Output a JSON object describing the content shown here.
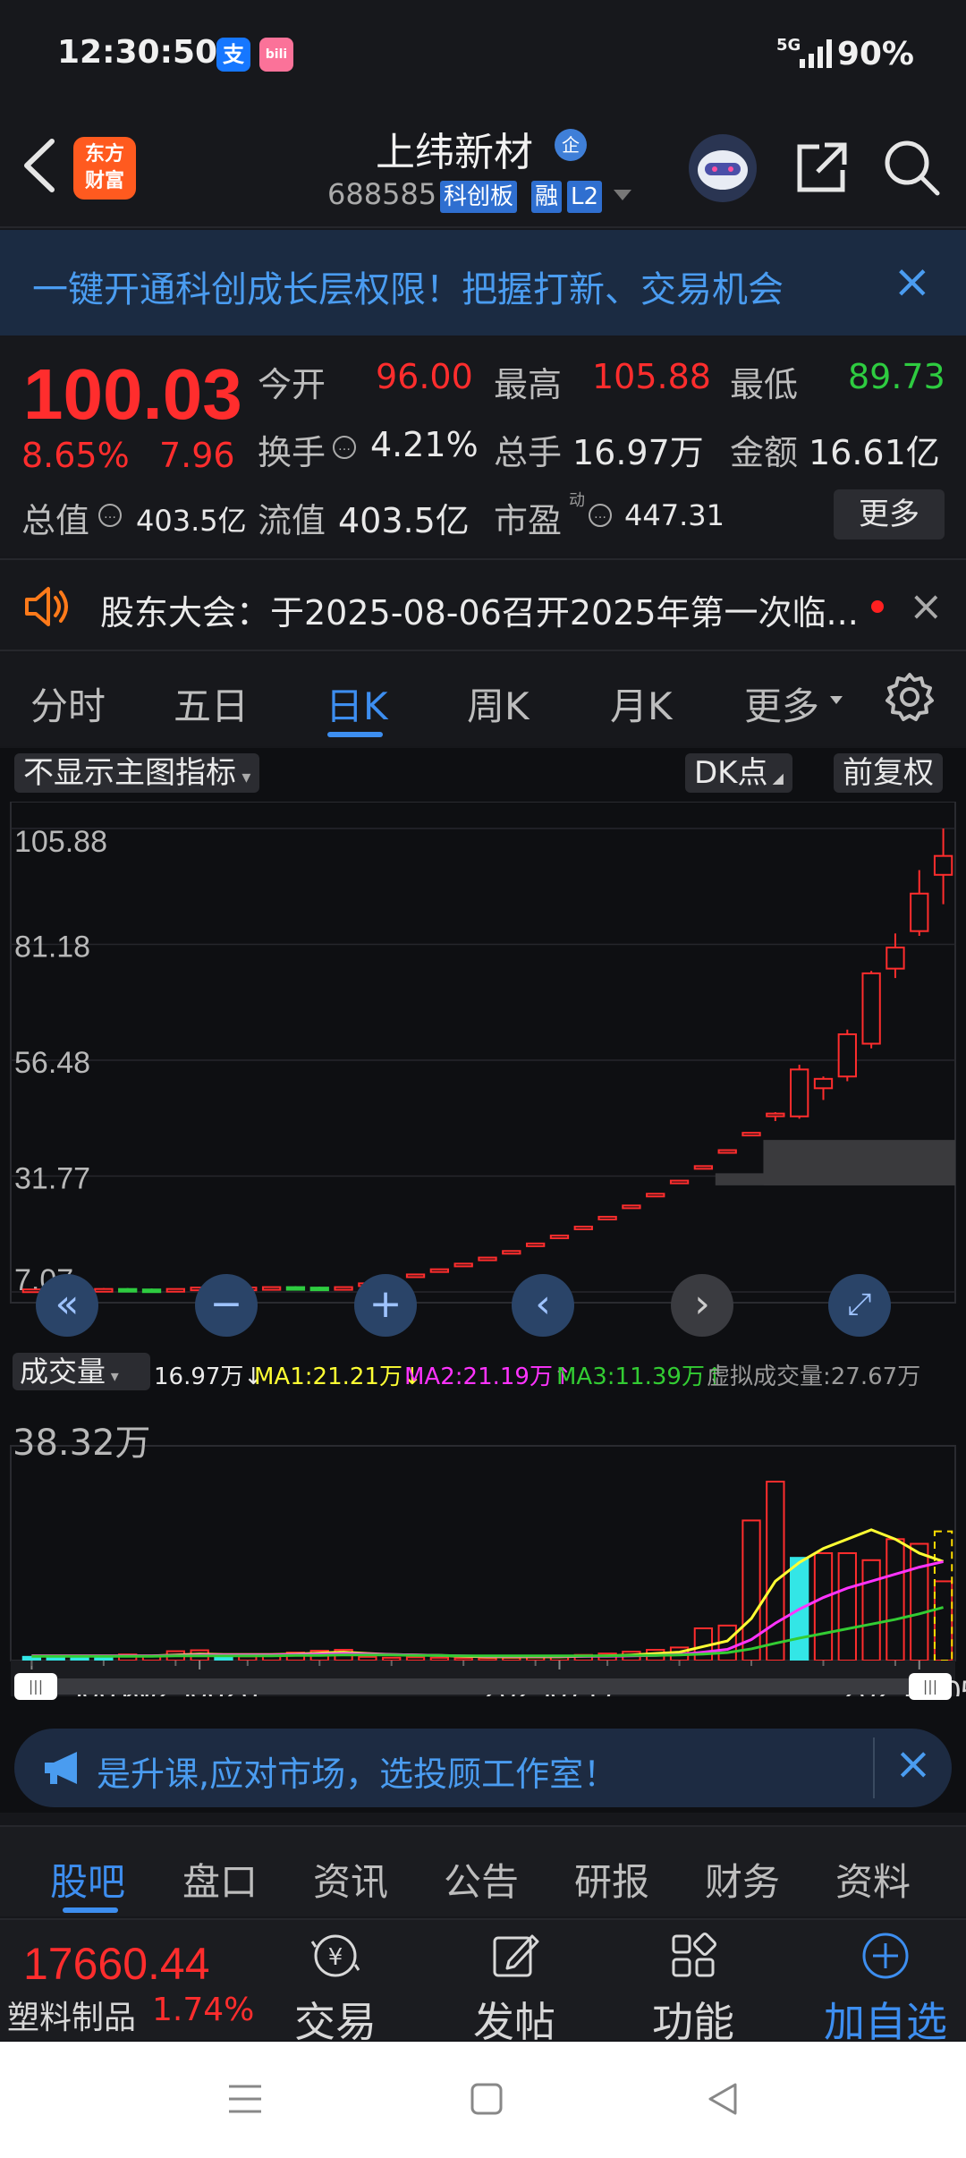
{
  "status_bar": {
    "time": "12:30:50",
    "apps": [
      "支",
      "bili"
    ],
    "network": "5G",
    "battery": "90%"
  },
  "header": {
    "logo_line1": "东方",
    "logo_line2": "财富",
    "stock_name": "上纬新材",
    "qi_badge": "企",
    "stock_code": "688585",
    "tags": [
      "科创板",
      "融",
      "L2"
    ]
  },
  "banner": {
    "text": "一键开通科创成长层权限！把握打新、交易机会"
  },
  "quote": {
    "price": "100.03",
    "change_pct": "8.65%",
    "change_amt": "7.96",
    "open_label": "今开",
    "open": "96.00",
    "high_label": "最高",
    "high": "105.88",
    "low_label": "最低",
    "low": "89.73",
    "turnover_label": "换手",
    "turnover": "4.21%",
    "volume_label": "总手",
    "volume": "16.97万",
    "amount_label": "金额",
    "amount": "16.61亿",
    "mktcap_label": "总值",
    "mktcap": "403.5亿",
    "float_label": "流值",
    "float": "403.5亿",
    "pe_label": "市盈",
    "pe_sup": "动",
    "pe": "447.31",
    "more": "更多"
  },
  "notice": {
    "text": "股东大会：于2025-08-06召开2025年第一次临..."
  },
  "period_tabs": [
    "分时",
    "五日",
    "日K",
    "周K",
    "月K",
    "更多"
  ],
  "chart_controls": {
    "indicator": "不显示主图指标",
    "dk": "DK点",
    "adjust": "前复权",
    "volume_label": "成交量",
    "vol_value": "16.97万↓",
    "ma1": "MA1:21.21万↓",
    "ma2": "MA2:21.19万↑",
    "ma3": "MA3:11.39万↑",
    "virtual": "虚拟成交量:27.67万",
    "vol_max": "38.32万"
  },
  "colors": {
    "up": "#ff2d2d",
    "down": "#2ecc40",
    "accent": "#3d8ef0",
    "ma1": "#ffff33",
    "ma2": "#ff33ff",
    "ma3": "#33cc33"
  },
  "chart_data": {
    "type": "candlestick",
    "y_ticks": [
      "105.88",
      "81.18",
      "56.48",
      "31.77",
      "7.07"
    ],
    "ylim": [
      7.07,
      105.88
    ],
    "x_ticks": [
      "20250616",
      "20250626",
      "20250717",
      "20250805"
    ],
    "series": [
      {
        "o": 7.5,
        "h": 7.7,
        "l": 7.3,
        "c": 7.6
      },
      {
        "o": 7.6,
        "h": 7.8,
        "l": 7.4,
        "c": 7.5
      },
      {
        "o": 7.5,
        "h": 7.7,
        "l": 7.3,
        "c": 7.6
      },
      {
        "o": 7.6,
        "h": 7.9,
        "l": 7.5,
        "c": 7.7
      },
      {
        "o": 7.7,
        "h": 7.9,
        "l": 7.5,
        "c": 7.6
      },
      {
        "o": 7.6,
        "h": 7.8,
        "l": 7.4,
        "c": 7.5
      },
      {
        "o": 7.5,
        "h": 7.8,
        "l": 7.4,
        "c": 7.7
      },
      {
        "o": 7.7,
        "h": 8.1,
        "l": 7.6,
        "c": 8.0
      },
      {
        "o": 8.0,
        "h": 8.2,
        "l": 7.8,
        "c": 7.9
      },
      {
        "o": 7.9,
        "h": 8.1,
        "l": 7.7,
        "c": 8.0
      },
      {
        "o": 8.0,
        "h": 8.2,
        "l": 7.8,
        "c": 8.1
      },
      {
        "o": 8.1,
        "h": 8.3,
        "l": 7.9,
        "c": 8.0
      },
      {
        "o": 8.0,
        "h": 8.2,
        "l": 7.8,
        "c": 7.9
      },
      {
        "o": 7.9,
        "h": 8.2,
        "l": 7.8,
        "c": 8.1
      },
      {
        "o": 8.9,
        "h": 8.9,
        "l": 8.9,
        "c": 8.9
      },
      {
        "o": 9.8,
        "h": 9.8,
        "l": 9.8,
        "c": 9.8
      },
      {
        "o": 10.8,
        "h": 10.8,
        "l": 10.8,
        "c": 10.8
      },
      {
        "o": 11.9,
        "h": 11.9,
        "l": 11.9,
        "c": 11.9
      },
      {
        "o": 13.1,
        "h": 13.1,
        "l": 13.1,
        "c": 13.1
      },
      {
        "o": 14.4,
        "h": 14.4,
        "l": 14.4,
        "c": 14.4
      },
      {
        "o": 15.8,
        "h": 15.8,
        "l": 15.8,
        "c": 15.8
      },
      {
        "o": 17.4,
        "h": 17.4,
        "l": 17.4,
        "c": 17.4
      },
      {
        "o": 19.1,
        "h": 19.1,
        "l": 19.1,
        "c": 19.1
      },
      {
        "o": 21.0,
        "h": 21.0,
        "l": 21.0,
        "c": 21.0
      },
      {
        "o": 23.1,
        "h": 23.1,
        "l": 23.1,
        "c": 23.1
      },
      {
        "o": 25.5,
        "h": 25.5,
        "l": 25.5,
        "c": 25.5
      },
      {
        "o": 28.0,
        "h": 28.0,
        "l": 28.0,
        "c": 28.0
      },
      {
        "o": 30.8,
        "h": 30.8,
        "l": 30.8,
        "c": 30.8
      },
      {
        "o": 33.9,
        "h": 33.9,
        "l": 33.9,
        "c": 33.9
      },
      {
        "o": 37.3,
        "h": 37.3,
        "l": 37.3,
        "c": 37.3
      },
      {
        "o": 41.0,
        "h": 41.0,
        "l": 41.0,
        "c": 41.0
      },
      {
        "o": 45.1,
        "h": 45.4,
        "l": 43.5,
        "c": 45.1
      },
      {
        "o": 44.5,
        "h": 55.5,
        "l": 44.0,
        "c": 54.5
      },
      {
        "o": 50.5,
        "h": 53.0,
        "l": 48.0,
        "c": 52.5
      },
      {
        "o": 53.0,
        "h": 63.0,
        "l": 52.0,
        "c": 62.0
      },
      {
        "o": 60.0,
        "h": 75.5,
        "l": 59.0,
        "c": 75.0
      },
      {
        "o": 76.0,
        "h": 83.5,
        "l": 74.0,
        "c": 80.5
      },
      {
        "o": 84.0,
        "h": 97.0,
        "l": 83.0,
        "c": 92.0
      },
      {
        "o": 96.0,
        "h": 105.88,
        "l": 89.73,
        "c": 100.03
      }
    ],
    "volume": {
      "max_label": "38.32万",
      "bars": [
        {
          "v": 0.8,
          "up": false
        },
        {
          "v": 0.9,
          "up": false
        },
        {
          "v": 0.7,
          "up": false
        },
        {
          "v": 0.8,
          "up": false
        },
        {
          "v": 1.3,
          "up": true
        },
        {
          "v": 0.9,
          "up": true
        },
        {
          "v": 2.0,
          "up": true
        },
        {
          "v": 2.2,
          "up": true
        },
        {
          "v": 1.0,
          "up": false
        },
        {
          "v": 0.9,
          "up": true
        },
        {
          "v": 1.1,
          "up": true
        },
        {
          "v": 1.7,
          "up": true
        },
        {
          "v": 2.1,
          "up": true
        },
        {
          "v": 2.3,
          "up": true
        },
        {
          "v": 0.8,
          "up": true
        },
        {
          "v": 0.6,
          "up": true
        },
        {
          "v": 0.7,
          "up": true
        },
        {
          "v": 0.6,
          "up": true
        },
        {
          "v": 0.5,
          "up": true
        },
        {
          "v": 0.5,
          "up": true
        },
        {
          "v": 0.6,
          "up": true
        },
        {
          "v": 0.7,
          "up": true
        },
        {
          "v": 0.9,
          "up": true
        },
        {
          "v": 1.2,
          "up": true
        },
        {
          "v": 1.5,
          "up": true
        },
        {
          "v": 1.9,
          "up": true
        },
        {
          "v": 2.3,
          "up": true
        },
        {
          "v": 2.8,
          "up": true
        },
        {
          "v": 6.9,
          "up": true
        },
        {
          "v": 7.5,
          "up": true
        },
        {
          "v": 30.0,
          "up": true
        },
        {
          "v": 38.32,
          "up": true
        },
        {
          "v": 22.0,
          "up": false
        },
        {
          "v": 23.0,
          "up": true
        },
        {
          "v": 23.0,
          "up": true
        },
        {
          "v": 21.5,
          "up": true
        },
        {
          "v": 26.0,
          "up": true
        },
        {
          "v": 25.0,
          "up": true
        },
        {
          "v": 16.97,
          "up": true
        }
      ],
      "ma1": [
        1,
        1,
        1,
        1,
        1,
        1,
        1.2,
        1.4,
        1.3,
        1.3,
        1.3,
        1.4,
        1.6,
        1.8,
        1.5,
        1.3,
        1.2,
        1.1,
        0.9,
        0.8,
        0.8,
        0.8,
        0.8,
        0.9,
        1.0,
        1.2,
        1.5,
        1.8,
        3.0,
        4.2,
        9.0,
        17.0,
        21.0,
        24.0,
        26.0,
        28.0,
        26.0,
        23.0,
        21.21
      ],
      "ma2": [
        1,
        1,
        1,
        1,
        1,
        1,
        1.1,
        1.2,
        1.2,
        1.2,
        1.2,
        1.3,
        1.4,
        1.5,
        1.4,
        1.3,
        1.2,
        1.1,
        1.0,
        0.9,
        0.9,
        0.9,
        0.9,
        0.9,
        0.9,
        1.0,
        1.1,
        1.3,
        1.8,
        2.4,
        4.5,
        8.0,
        11.0,
        13.5,
        15.5,
        17.0,
        18.5,
        20.0,
        21.19
      ],
      "ma3": [
        0.9,
        0.9,
        0.9,
        0.9,
        0.9,
        0.9,
        1.0,
        1.0,
        1.0,
        1.0,
        1.0,
        1.1,
        1.1,
        1.2,
        1.2,
        1.2,
        1.1,
        1.1,
        1.0,
        1.0,
        1.0,
        1.0,
        1.0,
        1.0,
        1.0,
        1.1,
        1.1,
        1.2,
        1.4,
        1.7,
        2.5,
        3.7,
        4.8,
        5.8,
        6.8,
        7.8,
        8.8,
        10.0,
        11.39
      ],
      "virtual_value": 27.67
    }
  },
  "promo": {
    "text": "是升课,应对市场，选投顾工作室！"
  },
  "bottom_tabs": [
    "股吧",
    "盘口",
    "资讯",
    "公告",
    "研报",
    "财务",
    "资料"
  ],
  "action_bar": {
    "index_value": "17660.44",
    "index_name": "塑料制品",
    "index_pct": "1.74%",
    "actions": [
      {
        "label": "交易",
        "icon": "trade-icon"
      },
      {
        "label": "发帖",
        "icon": "post-icon"
      },
      {
        "label": "功能",
        "icon": "grid-icon"
      },
      {
        "label": "加自选",
        "icon": "add-watchlist-icon"
      }
    ]
  }
}
